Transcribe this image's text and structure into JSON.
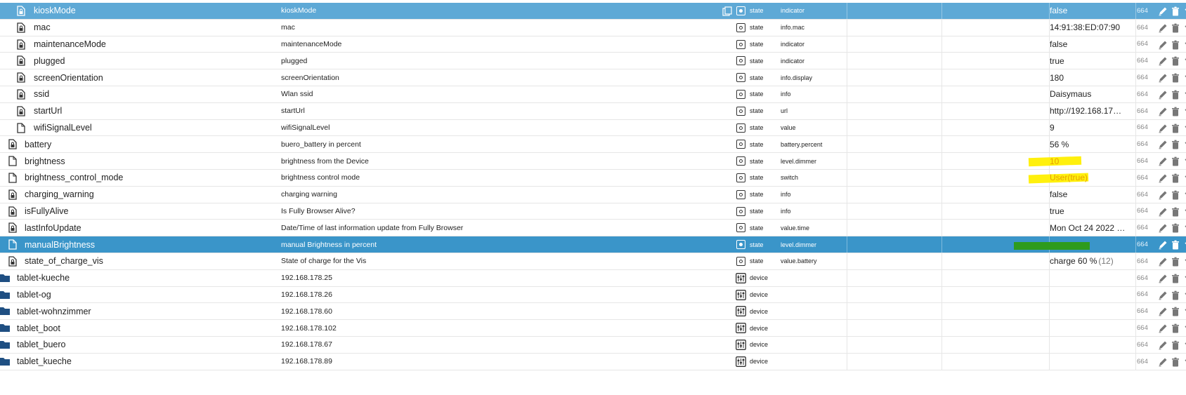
{
  "rows": [
    {
      "kind": "state",
      "indent": 1,
      "icon": "lock-file",
      "name": "kioskMode",
      "desc": "kioskMode",
      "type": "state",
      "role": "indicator",
      "value": "false",
      "acl": "664",
      "selected": "light",
      "copy": true
    },
    {
      "kind": "state",
      "indent": 1,
      "icon": "lock-file",
      "name": "mac",
      "desc": "mac",
      "type": "state",
      "role": "info.mac",
      "value": "14:91:38:ED:07:90",
      "acl": "664"
    },
    {
      "kind": "state",
      "indent": 1,
      "icon": "lock-file",
      "name": "maintenanceMode",
      "desc": "maintenanceMode",
      "type": "state",
      "role": "indicator",
      "value": "false",
      "acl": "664"
    },
    {
      "kind": "state",
      "indent": 1,
      "icon": "lock-file",
      "name": "plugged",
      "desc": "plugged",
      "type": "state",
      "role": "indicator",
      "value": "true",
      "acl": "664"
    },
    {
      "kind": "state",
      "indent": 1,
      "icon": "lock-file",
      "name": "screenOrientation",
      "desc": "screenOrientation",
      "type": "state",
      "role": "info.display",
      "value": "180",
      "acl": "664"
    },
    {
      "kind": "state",
      "indent": 1,
      "icon": "lock-file",
      "name": "ssid",
      "desc": "Wlan ssid",
      "type": "state",
      "role": "info",
      "value": "Daisymaus",
      "acl": "664"
    },
    {
      "kind": "state",
      "indent": 1,
      "icon": "lock-file",
      "name": "startUrl",
      "desc": "startUrl",
      "type": "state",
      "role": "url",
      "value": "http://192.168.17…",
      "acl": "664"
    },
    {
      "kind": "state",
      "indent": 1,
      "icon": "file",
      "name": "wifiSignalLevel",
      "desc": "wifiSignalLevel",
      "type": "state",
      "role": "value",
      "value": "9",
      "acl": "664"
    },
    {
      "kind": "state",
      "indent": 0,
      "icon": "lock-file",
      "name": "battery",
      "desc": "buero_battery in percent",
      "type": "state",
      "role": "battery.percent",
      "value": "56 %",
      "acl": "664"
    },
    {
      "kind": "state",
      "indent": 0,
      "icon": "file",
      "name": "brightness",
      "desc": "brightness from the Device",
      "type": "state",
      "role": "level.dimmer",
      "value": "10",
      "acl": "664",
      "highlight": "yellow"
    },
    {
      "kind": "state",
      "indent": 0,
      "icon": "file",
      "name": "brightness_control_mode",
      "desc": "brightness control mode",
      "type": "state",
      "role": "switch",
      "value": "User(true)",
      "acl": "664",
      "highlight": "yellow"
    },
    {
      "kind": "state",
      "indent": 0,
      "icon": "lock-file",
      "name": "charging_warning",
      "desc": "charging warning",
      "type": "state",
      "role": "info",
      "value": "false",
      "acl": "664"
    },
    {
      "kind": "state",
      "indent": 0,
      "icon": "lock-file",
      "name": "isFullyAlive",
      "desc": "Is Fully Browser Alive?",
      "type": "state",
      "role": "info",
      "value": "true",
      "acl": "664"
    },
    {
      "kind": "state",
      "indent": 0,
      "icon": "lock-file",
      "name": "lastInfoUpdate",
      "desc": "Date/Time of last information update from Fully Browser",
      "type": "state",
      "role": "value.time",
      "value": "Mon Oct 24 2022 …",
      "acl": "664"
    },
    {
      "kind": "state",
      "indent": 0,
      "icon": "file",
      "name": "manualBrightness",
      "desc": "manual Brightness in percent",
      "type": "state",
      "role": "level.dimmer",
      "value": "",
      "acl": "664",
      "selected": "dark",
      "highlight": "green"
    },
    {
      "kind": "state",
      "indent": 0,
      "icon": "lock-file",
      "name": "state_of_charge_vis",
      "desc": "State of charge for the Vis",
      "type": "state",
      "role": "value.battery",
      "value": "charge 60 %",
      "value_suffix": "(12)",
      "acl": "664"
    },
    {
      "kind": "device",
      "indent": -1,
      "icon": "folder",
      "name": "tablet-kueche",
      "desc": "192.168.178.25",
      "type": "device",
      "role": "",
      "value": "",
      "acl": "664"
    },
    {
      "kind": "device",
      "indent": -1,
      "icon": "folder",
      "name": "tablet-og",
      "desc": "192.168.178.26",
      "type": "device",
      "role": "",
      "value": "",
      "acl": "664"
    },
    {
      "kind": "device",
      "indent": -1,
      "icon": "folder",
      "name": "tablet-wohnzimmer",
      "desc": "192.168.178.60",
      "type": "device",
      "role": "",
      "value": "",
      "acl": "664"
    },
    {
      "kind": "device",
      "indent": -1,
      "icon": "folder",
      "name": "tablet_boot",
      "desc": "192.168.178.102",
      "type": "device",
      "role": "",
      "value": "",
      "acl": "664"
    },
    {
      "kind": "device",
      "indent": -1,
      "icon": "folder",
      "name": "tablet_buero",
      "desc": "192.168.178.67",
      "type": "device",
      "role": "",
      "value": "",
      "acl": "664"
    },
    {
      "kind": "device",
      "indent": -1,
      "icon": "folder",
      "name": "tablet_kueche",
      "desc": "192.168.178.89",
      "type": "device",
      "role": "",
      "value": "",
      "acl": "664"
    }
  ],
  "colors": {
    "accent_light": "#5ea9d6",
    "accent_dark": "#3a95c9",
    "folder": "#1f4f82",
    "highlight_yellow": "#ffef00",
    "highlight_green": "#2e9b1d"
  }
}
